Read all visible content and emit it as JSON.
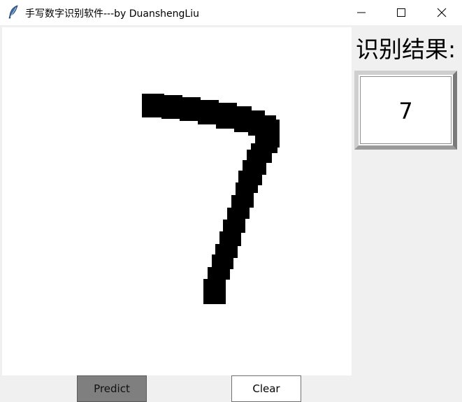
{
  "window": {
    "title": "手写数字识别软件---by DuanshengLiu"
  },
  "canvas": {
    "stroke_color": "#000000",
    "background": "#ffffff"
  },
  "result": {
    "label": "识别结果:",
    "value": "7"
  },
  "buttons": {
    "predict_label": "Predict",
    "clear_label": "Clear"
  },
  "icons": {
    "app": "feather-icon",
    "minimize": "minimize-icon",
    "maximize": "maximize-icon",
    "close": "close-icon"
  }
}
